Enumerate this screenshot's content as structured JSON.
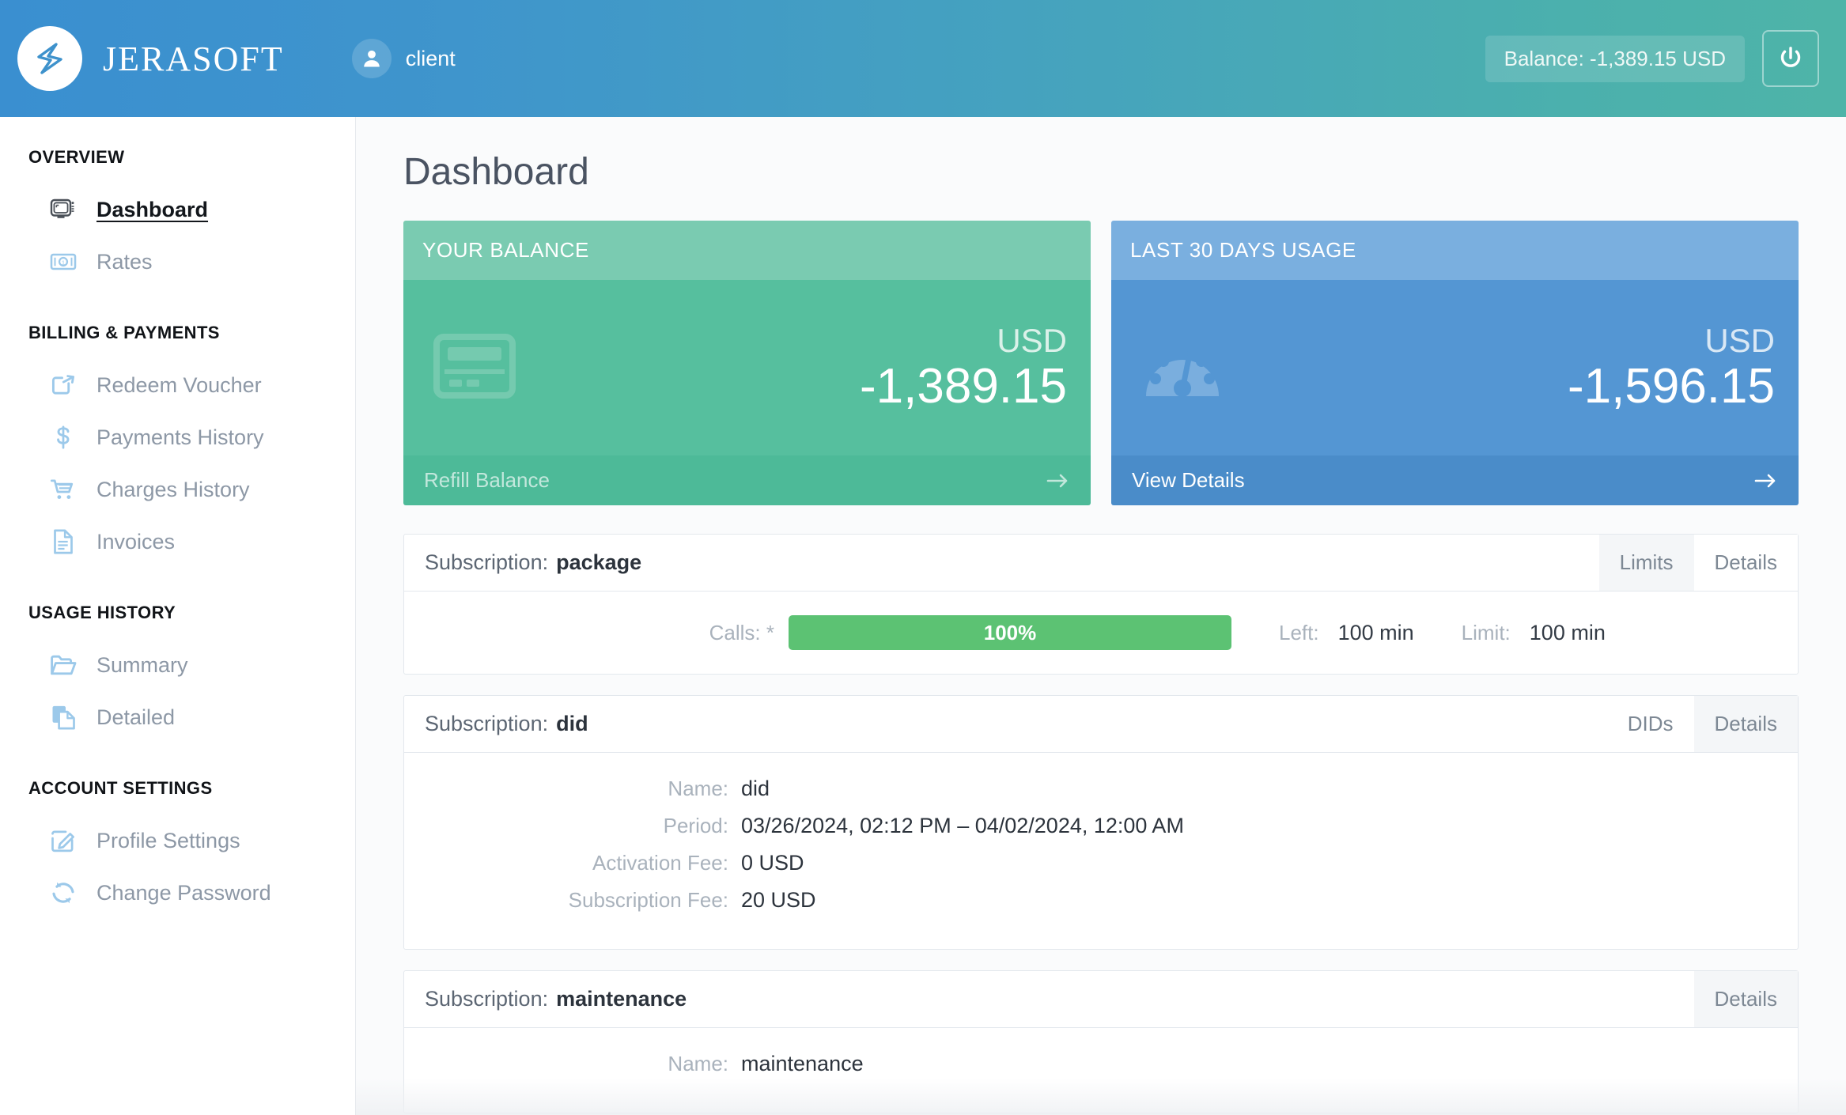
{
  "header": {
    "brand": "JERASOFT",
    "logo_icon": "jerasoft-logo-icon",
    "user_icon": "user-avatar-icon",
    "user_name": "client",
    "balance_pill": "Balance: -1,389.15 USD",
    "logout_icon": "power-icon",
    "gradient_from": "#3a8fd0",
    "gradient_to": "#4eb4a8"
  },
  "sidebar": {
    "groups": [
      {
        "title": "OVERVIEW",
        "items": [
          {
            "label": "Dashboard",
            "icon": "monitor-icon",
            "active": true
          },
          {
            "label": "Rates",
            "icon": "banknote-icon",
            "active": false
          }
        ]
      },
      {
        "title": "BILLING & PAYMENTS",
        "items": [
          {
            "label": "Redeem Voucher",
            "icon": "share-arrow-icon",
            "active": false
          },
          {
            "label": "Payments History",
            "icon": "dollar-icon",
            "active": false
          },
          {
            "label": "Charges History",
            "icon": "shopping-cart-icon",
            "active": false
          },
          {
            "label": "Invoices",
            "icon": "document-lines-icon",
            "active": false
          }
        ]
      },
      {
        "title": "USAGE HISTORY",
        "items": [
          {
            "label": "Summary",
            "icon": "open-folder-icon",
            "active": false
          },
          {
            "label": "Detailed",
            "icon": "copy-documents-icon",
            "active": false
          }
        ]
      },
      {
        "title": "ACCOUNT SETTINGS",
        "items": [
          {
            "label": "Profile Settings",
            "icon": "pencil-square-icon",
            "active": false
          },
          {
            "label": "Change Password",
            "icon": "refresh-cycle-icon",
            "active": false
          }
        ]
      }
    ]
  },
  "main": {
    "page_title": "Dashboard",
    "cards": [
      {
        "heading": "YOUR BALANCE",
        "currency": "USD",
        "value": "-1,389.15",
        "footer_label": "Refill Balance",
        "footer_arrow": "arrow-right-icon",
        "icon": "credit-card-icon",
        "accent": "#56bf9e"
      },
      {
        "heading": "LAST 30 DAYS USAGE",
        "currency": "USD",
        "value": "-1,596.15",
        "footer_label": "View Details",
        "footer_arrow": "arrow-right-icon",
        "icon": "gauge-icon",
        "accent": "#5496d3"
      }
    ],
    "subscriptions": [
      {
        "prefix": "Subscription:",
        "name": "package",
        "tabs": [
          {
            "label": "Limits",
            "active": true
          },
          {
            "label": "Details",
            "active": false
          }
        ],
        "kind": "limits",
        "limits": [
          {
            "label": "Calls: *",
            "percent_text": "100%",
            "percent": 100,
            "left_key": "Left:",
            "left_value": "100 min",
            "limit_key": "Limit:",
            "limit_value": "100 min",
            "bar_color": "#5cc273"
          }
        ]
      },
      {
        "prefix": "Subscription:",
        "name": "did",
        "tabs": [
          {
            "label": "DIDs",
            "active": false
          },
          {
            "label": "Details",
            "active": true
          }
        ],
        "kind": "details",
        "details": [
          {
            "key": "Name:",
            "value": "did"
          },
          {
            "key": "Period:",
            "value": "03/26/2024, 02:12 PM – 04/02/2024, 12:00 AM"
          },
          {
            "key": "Activation Fee:",
            "value": "0 USD"
          },
          {
            "key": "Subscription Fee:",
            "value": "20 USD"
          }
        ]
      },
      {
        "prefix": "Subscription:",
        "name": "maintenance",
        "tabs": [
          {
            "label": "Details",
            "active": true
          }
        ],
        "kind": "details",
        "details": [
          {
            "key": "Name:",
            "value": "maintenance"
          }
        ]
      }
    ]
  }
}
